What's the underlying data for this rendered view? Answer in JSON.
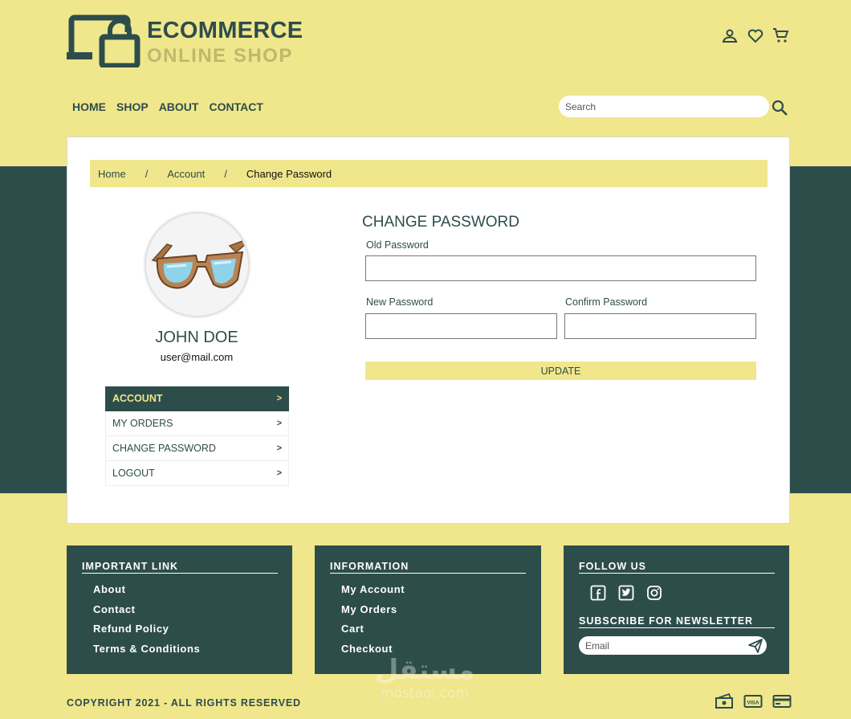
{
  "brand": {
    "title": "ECOMMERCE",
    "subtitle": "ONLINE SHOP"
  },
  "header_icons": [
    "user-icon",
    "heart-icon",
    "cart-icon"
  ],
  "nav": {
    "items": [
      {
        "label": "HOME"
      },
      {
        "label": "SHOP"
      },
      {
        "label": "ABOUT"
      },
      {
        "label": "CONTACT"
      }
    ]
  },
  "search": {
    "placeholder": "Search",
    "value": ""
  },
  "breadcrumb": {
    "items": [
      "Home",
      "Account",
      "Change Password"
    ],
    "separator": "/"
  },
  "profile": {
    "name": "JOHN DOE",
    "email": "user@mail.com",
    "avatar_icon": "sunglasses-image"
  },
  "side_menu": {
    "items": [
      {
        "label": "ACCOUNT",
        "arrow": ">",
        "active": true
      },
      {
        "label": "MY ORDERS",
        "arrow": ">",
        "active": false
      },
      {
        "label": "CHANGE PASSWORD",
        "arrow": ">",
        "active": false
      },
      {
        "label": "LOGOUT",
        "arrow": ">",
        "active": false
      }
    ]
  },
  "form": {
    "title": "CHANGE PASSWORD",
    "old_password_label": "Old Password",
    "old_password_value": "",
    "new_password_label": "New Password",
    "new_password_value": "",
    "confirm_password_label": "Confirm Password",
    "confirm_password_value": "",
    "submit_label": "UPDATE"
  },
  "footer": {
    "important_links": {
      "title": "IMPORTANT LINK",
      "items": [
        "About",
        "Contact",
        "Refund Policy",
        "Terms & Conditions"
      ]
    },
    "information": {
      "title": "INFORMATION",
      "items": [
        "My Account",
        "My Orders",
        "Cart",
        "Checkout"
      ]
    },
    "follow": {
      "title": "FOLLOW US",
      "icons": [
        "facebook-icon",
        "twitter-icon",
        "instagram-icon"
      ],
      "newsletter_title": "SUBSCRIBE FOR NEWSLETTER",
      "email_placeholder": "Email"
    },
    "copyright": "COPYRIGHT 2021 - ALL RIGHTS RESERVED",
    "payment_icons": [
      "cash-icon",
      "visa-icon",
      "card-icon"
    ]
  },
  "watermark": {
    "arabic": "مستقل",
    "latin": "mostaqi.com"
  },
  "colors": {
    "primary": "#2d4d4b",
    "accent": "#f0e68c",
    "muted": "#c2b76c",
    "surface": "#ffffff"
  }
}
